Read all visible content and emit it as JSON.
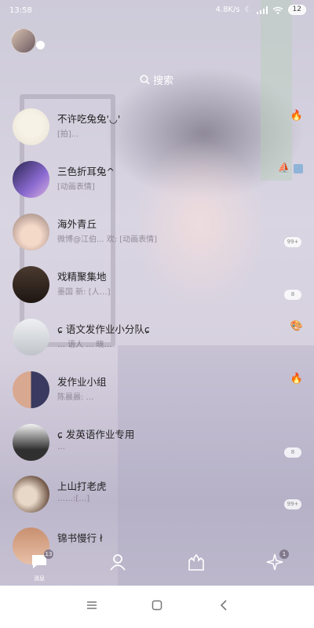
{
  "status_bar": {
    "time": "13:58",
    "net_speed": "4.8K/s",
    "battery": "12"
  },
  "search": {
    "label": "搜索"
  },
  "chats": [
    {
      "title": "不许吃兔兔'◡'",
      "preview": "[拍]... ",
      "right_icon": "🔥",
      "badge": ""
    },
    {
      "title": "三色折耳兔^",
      "preview": "[动画表情]",
      "right_icon": "⛵",
      "badge": ""
    },
    {
      "title": "海外青丘",
      "preview": "微博@江伯... 欢: [动画表情]",
      "right_icon": "",
      "badge": "99+"
    },
    {
      "title": "戏精聚集地",
      "preview": "墨国 新: [人…]",
      "right_icon": "",
      "badge": "8"
    },
    {
      "title": "ɕ 语文发作业小分队ɕ",
      "preview": "… 语人 … 晓…",
      "right_icon": "🎨",
      "badge": ""
    },
    {
      "title": "发作业小组",
      "preview": "陈晨晨: …",
      "right_icon": "🔥",
      "badge": ""
    },
    {
      "title": "ɕ 发英语作业专用",
      "preview": "…",
      "right_icon": "",
      "badge": "8"
    },
    {
      "title": "上山打老虎",
      "preview": "……:[…]",
      "right_icon": "",
      "badge": "99+"
    },
    {
      "title": "锦书慢行 ł",
      "preview": "",
      "right_icon": "",
      "badge": ""
    }
  ],
  "tabbar": {
    "messages": {
      "label": "消息",
      "count": "13"
    },
    "contacts": {
      "label": ""
    },
    "dynamic": {
      "label": ""
    },
    "discover": {
      "count": "1"
    }
  },
  "icons": {
    "status_wifi": "wifi-icon",
    "status_moon": "moon-icon",
    "status_signal": "signal-icon"
  }
}
